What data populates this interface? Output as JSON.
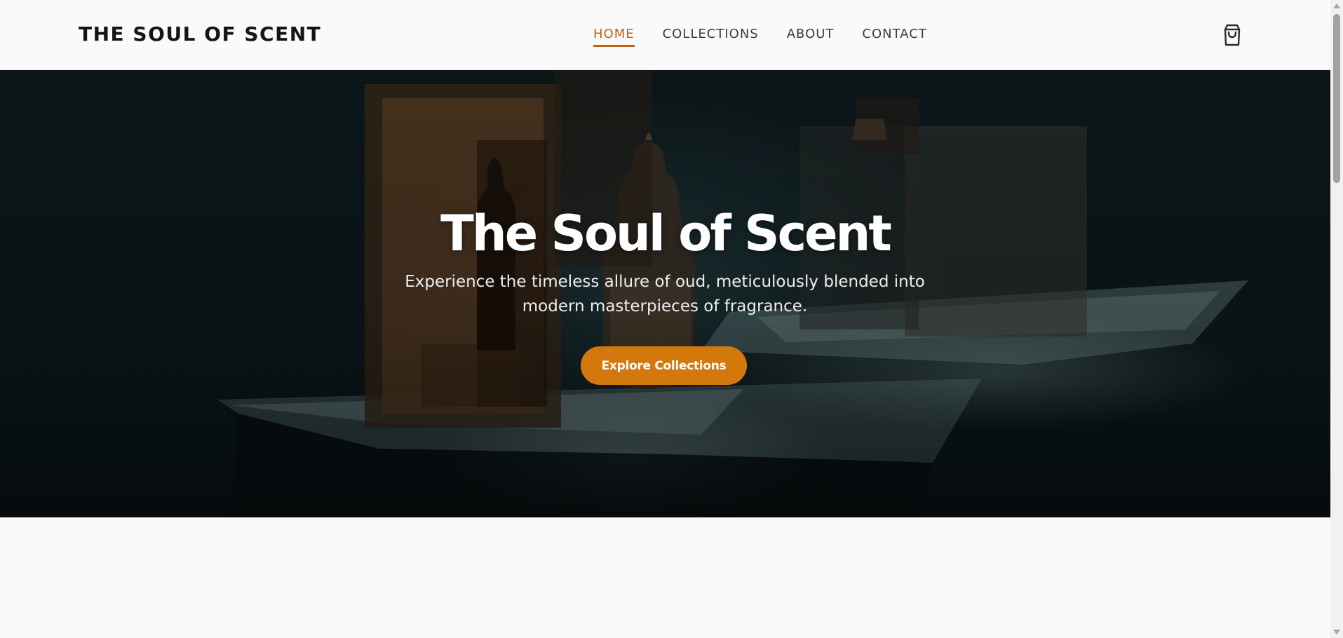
{
  "header": {
    "brand": "THE SOUL OF SCENT",
    "nav": [
      {
        "label": "HOME",
        "active": true
      },
      {
        "label": "COLLECTIONS",
        "active": false
      },
      {
        "label": "ABOUT",
        "active": false
      },
      {
        "label": "CONTACT",
        "active": false
      }
    ],
    "cart_icon": "shopping-bag-icon"
  },
  "hero": {
    "title": "The Soul of Scent",
    "subtitle": "Experience the timeless allure of oud, meticulously blended into modern masterpieces of fragrance.",
    "cta_label": "Explore Collections",
    "image_subject": "perfume bottles on illuminated display"
  },
  "colors": {
    "accent": "#c2620d",
    "cta": "#d3780c",
    "background": "#fafafa",
    "brand_text": "#141414"
  }
}
